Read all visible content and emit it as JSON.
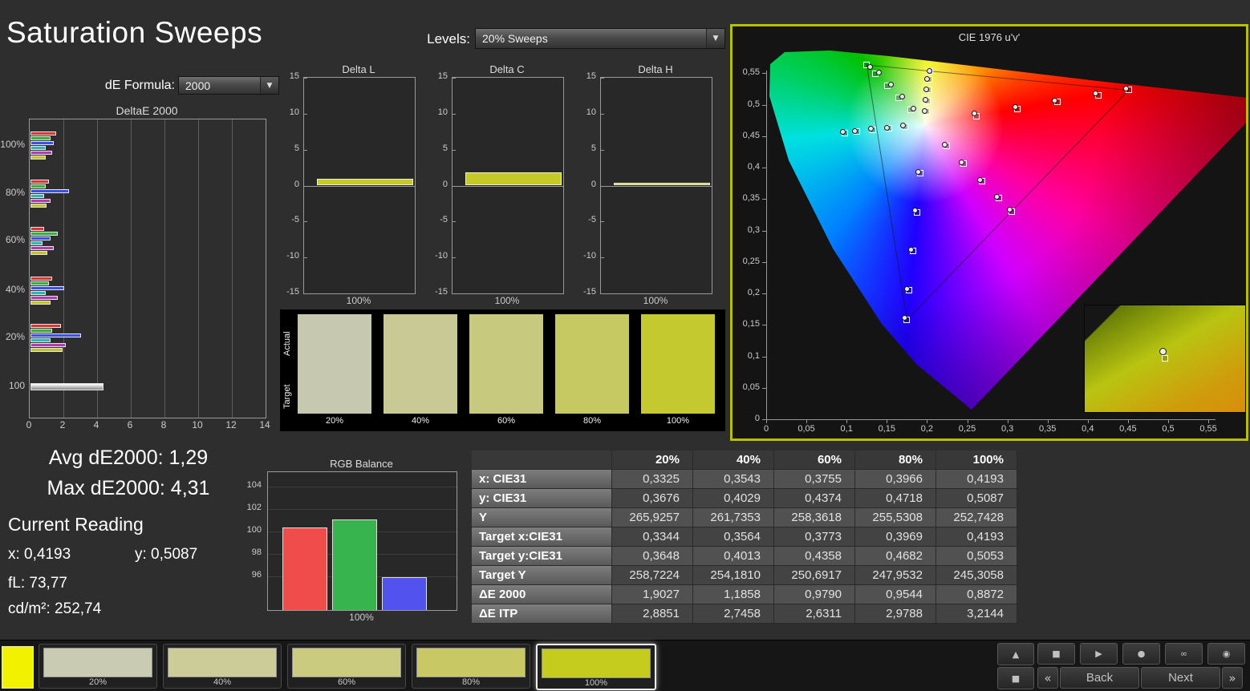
{
  "header": {
    "title": "Saturation Sweeps",
    "levels_label": "Levels:",
    "levels_value": "20% Sweeps",
    "de_formula_label": "dE Formula:",
    "de_formula_value": "2000"
  },
  "icons": {
    "dropdown_arrow": "▼"
  },
  "summary": {
    "avg_de2000": "Avg dE2000: 1,29",
    "max_de2000": "Max dE2000: 4,31",
    "current_reading_title": "Current Reading",
    "x": "x: 0,4193",
    "y": "y: 0,5087",
    "fl": "fL: 73,77",
    "cdm2": "cd/m²: 252,74"
  },
  "chart_data": [
    {
      "id": "deltae2000",
      "type": "bar",
      "orientation": "horizontal",
      "title": "DeltaE 2000",
      "xlim": [
        0,
        14
      ],
      "xticks": [
        0,
        2,
        4,
        6,
        8,
        10,
        12,
        14
      ],
      "series_colors": {
        "red": "#e03434",
        "green": "#35b135",
        "blue": "#3a50e8",
        "cyan": "#2ab8b8",
        "magenta": "#b43ab4",
        "yellow": "#c2c525"
      },
      "groups": [
        {
          "label": "100%",
          "bars": [
            [
              "red",
              1.5
            ],
            [
              "green",
              1.2
            ],
            [
              "blue",
              1.4
            ],
            [
              "cyan",
              0.9
            ],
            [
              "magenta",
              1.3
            ],
            [
              "yellow",
              0.89
            ]
          ]
        },
        {
          "label": "80%",
          "bars": [
            [
              "red",
              1.1
            ],
            [
              "green",
              0.9
            ],
            [
              "blue",
              2.3
            ],
            [
              "cyan",
              0.8
            ],
            [
              "magenta",
              1.2
            ],
            [
              "yellow",
              0.95
            ]
          ]
        },
        {
          "label": "60%",
          "bars": [
            [
              "red",
              0.8
            ],
            [
              "green",
              1.6
            ],
            [
              "blue",
              1.2
            ],
            [
              "cyan",
              0.7
            ],
            [
              "magenta",
              1.4
            ],
            [
              "yellow",
              0.98
            ]
          ]
        },
        {
          "label": "40%",
          "bars": [
            [
              "red",
              1.3
            ],
            [
              "green",
              1.1
            ],
            [
              "blue",
              2.0
            ],
            [
              "cyan",
              0.9
            ],
            [
              "magenta",
              1.6
            ],
            [
              "yellow",
              1.19
            ]
          ]
        },
        {
          "label": "20%",
          "bars": [
            [
              "red",
              1.8
            ],
            [
              "green",
              1.3
            ],
            [
              "blue",
              3.0
            ],
            [
              "cyan",
              1.2
            ],
            [
              "magenta",
              2.1
            ],
            [
              "yellow",
              1.9
            ]
          ]
        },
        {
          "label": "100",
          "bars": [
            [
              "gray",
              4.31
            ]
          ],
          "grayscale": true
        }
      ]
    },
    {
      "id": "delta_l",
      "type": "bar",
      "title": "Delta L",
      "ylim": [
        -15,
        15
      ],
      "yticks": [
        15,
        10,
        5,
        0,
        -5,
        -10,
        -15
      ],
      "categories": [
        "100%"
      ],
      "values": [
        1.0
      ],
      "bar_color": "#c6ca28"
    },
    {
      "id": "delta_c",
      "type": "bar",
      "title": "Delta C",
      "ylim": [
        -15,
        15
      ],
      "yticks": [
        15,
        10,
        5,
        0,
        -5,
        -10,
        -15
      ],
      "categories": [
        "100%"
      ],
      "values": [
        1.8
      ],
      "bar_color": "#c6ca28"
    },
    {
      "id": "delta_h",
      "type": "bar",
      "title": "Delta H",
      "ylim": [
        -15,
        15
      ],
      "yticks": [
        15,
        10,
        5,
        0,
        -5,
        -10,
        -15
      ],
      "categories": [
        "100%"
      ],
      "values": [
        0.4
      ],
      "bar_color": "#c6ca28"
    },
    {
      "id": "cie_diagram",
      "type": "scatter",
      "title": "CIE 1976 u'v'",
      "xlim": [
        0,
        0.62
      ],
      "ylim": [
        0,
        0.585
      ],
      "tick_step": 0.05,
      "ticks": [
        "0",
        "0,05",
        "0,1",
        "0,15",
        "0,2",
        "0,25",
        "0,3",
        "0,35",
        "0,4",
        "0,45",
        "0,5",
        "0,55"
      ],
      "white_point": [
        0.198,
        0.468
      ],
      "sweeps": [
        {
          "name": "red",
          "targets": [
            [
              0.261,
              0.482
            ],
            [
              0.312,
              0.493
            ],
            [
              0.362,
              0.504
            ],
            [
              0.413,
              0.515
            ],
            [
              0.451,
              0.523
            ]
          ],
          "measured": [
            [
              0.258,
              0.486
            ],
            [
              0.309,
              0.497
            ],
            [
              0.358,
              0.507
            ],
            [
              0.409,
              0.518
            ],
            [
              0.447,
              0.526
            ]
          ]
        },
        {
          "name": "green",
          "targets": [
            [
              0.18,
              0.492
            ],
            [
              0.165,
              0.511
            ],
            [
              0.151,
              0.53
            ],
            [
              0.136,
              0.549
            ],
            [
              0.125,
              0.563
            ]
          ],
          "measured": [
            [
              0.183,
              0.494
            ],
            [
              0.169,
              0.513
            ],
            [
              0.155,
              0.532
            ],
            [
              0.14,
              0.551
            ],
            [
              0.129,
              0.561
            ]
          ]
        },
        {
          "name": "blue",
          "targets": [
            [
              0.192,
              0.391
            ],
            [
              0.188,
              0.329
            ],
            [
              0.183,
              0.267
            ],
            [
              0.178,
              0.205
            ],
            [
              0.175,
              0.158
            ]
          ],
          "measured": [
            [
              0.189,
              0.394
            ],
            [
              0.185,
              0.332
            ],
            [
              0.18,
              0.27
            ],
            [
              0.175,
              0.208
            ],
            [
              0.172,
              0.162
            ]
          ]
        },
        {
          "name": "cyan",
          "targets": [
            [
              0.173,
              0.465
            ],
            [
              0.153,
              0.462
            ],
            [
              0.133,
              0.46
            ],
            [
              0.113,
              0.457
            ],
            [
              0.098,
              0.455
            ]
          ],
          "measured": [
            [
              0.17,
              0.467
            ],
            [
              0.15,
              0.464
            ],
            [
              0.13,
              0.462
            ],
            [
              0.11,
              0.459
            ],
            [
              0.095,
              0.457
            ]
          ]
        },
        {
          "name": "magenta",
          "targets": [
            [
              0.225,
              0.434
            ],
            [
              0.246,
              0.406
            ],
            [
              0.268,
              0.378
            ],
            [
              0.289,
              0.351
            ],
            [
              0.305,
              0.33
            ]
          ],
          "measured": [
            [
              0.222,
              0.437
            ],
            [
              0.243,
              0.409
            ],
            [
              0.265,
              0.381
            ],
            [
              0.286,
              0.354
            ],
            [
              0.302,
              0.334
            ]
          ]
        },
        {
          "name": "yellow",
          "targets": [
            [
              0.2,
              0.489
            ],
            [
              0.201,
              0.506
            ],
            [
              0.202,
              0.523
            ],
            [
              0.203,
              0.54
            ],
            [
              0.204,
              0.553
            ]
          ],
          "measured": [
            [
              0.197,
              0.491
            ],
            [
              0.198,
              0.508
            ],
            [
              0.199,
              0.525
            ],
            [
              0.2,
              0.542
            ],
            [
              0.203,
              0.554
            ]
          ]
        }
      ]
    },
    {
      "id": "rgb_balance",
      "type": "bar",
      "title": "RGB Balance",
      "ylim": [
        93,
        105.3
      ],
      "yticks": [
        104,
        102,
        100,
        98,
        96
      ],
      "series": [
        {
          "name": "red",
          "value": 100.4,
          "color": "#f04c4c"
        },
        {
          "name": "green",
          "value": 101.1,
          "color": "#38b44e"
        },
        {
          "name": "blue",
          "value": 95.9,
          "color": "#5252ee"
        }
      ],
      "xlabel": "100%"
    }
  ],
  "swatch_strip": {
    "row_labels": [
      "Actual",
      "Target"
    ],
    "items": [
      {
        "label": "20%",
        "color": "#c6c8af"
      },
      {
        "label": "40%",
        "color": "#c8c995"
      },
      {
        "label": "60%",
        "color": "#c7c97e"
      },
      {
        "label": "80%",
        "color": "#c6c862"
      },
      {
        "label": "100%",
        "color": "#c3c92e"
      }
    ]
  },
  "table": {
    "columns": [
      "",
      "20%",
      "40%",
      "60%",
      "80%",
      "100%"
    ],
    "rows": [
      {
        "label": "x: CIE31",
        "values": [
          "0,3325",
          "0,3543",
          "0,3755",
          "0,3966",
          "0,4193"
        ]
      },
      {
        "label": "y: CIE31",
        "values": [
          "0,3676",
          "0,4029",
          "0,4374",
          "0,4718",
          "0,5087"
        ]
      },
      {
        "label": "Y",
        "values": [
          "265,9257",
          "261,7353",
          "258,3618",
          "255,5308",
          "252,7428"
        ]
      },
      {
        "label": "Target x:CIE31",
        "values": [
          "0,3344",
          "0,3564",
          "0,3773",
          "0,3969",
          "0,4193"
        ]
      },
      {
        "label": "Target y:CIE31",
        "values": [
          "0,3648",
          "0,4013",
          "0,4358",
          "0,4682",
          "0,5053"
        ]
      },
      {
        "label": "Target Y",
        "values": [
          "258,7224",
          "254,1810",
          "250,6917",
          "247,9532",
          "245,3058"
        ]
      },
      {
        "label": "ΔE 2000",
        "values": [
          "1,9027",
          "1,1858",
          "0,9790",
          "0,9544",
          "0,8872"
        ]
      },
      {
        "label": "ΔE ITP",
        "values": [
          "2,8851",
          "2,7458",
          "2,6311",
          "2,9788",
          "3,2144"
        ]
      }
    ]
  },
  "bottom_bar": {
    "active_color": "#f2f200",
    "patches": [
      {
        "label": "20%",
        "color": "#c9cbb3",
        "selected": false
      },
      {
        "label": "40%",
        "color": "#cbcc97",
        "selected": false
      },
      {
        "label": "60%",
        "color": "#cacb7f",
        "selected": false
      },
      {
        "label": "80%",
        "color": "#c8c964",
        "selected": false
      },
      {
        "label": "100%",
        "color": "#c6cc1e",
        "selected": true
      }
    ],
    "controls": {
      "back": "Back",
      "next": "Next",
      "prev_symbol": "«",
      "next_symbol": "»",
      "icons": [
        "up-arrow",
        "layout-square",
        "stop",
        "play",
        "record",
        "loop",
        "power"
      ]
    }
  },
  "control_glyphs": {
    "up-arrow": "▲",
    "layout-square": "■",
    "stop": "■",
    "play": "▶",
    "record": "●",
    "loop": "∞",
    "power": "◉"
  }
}
